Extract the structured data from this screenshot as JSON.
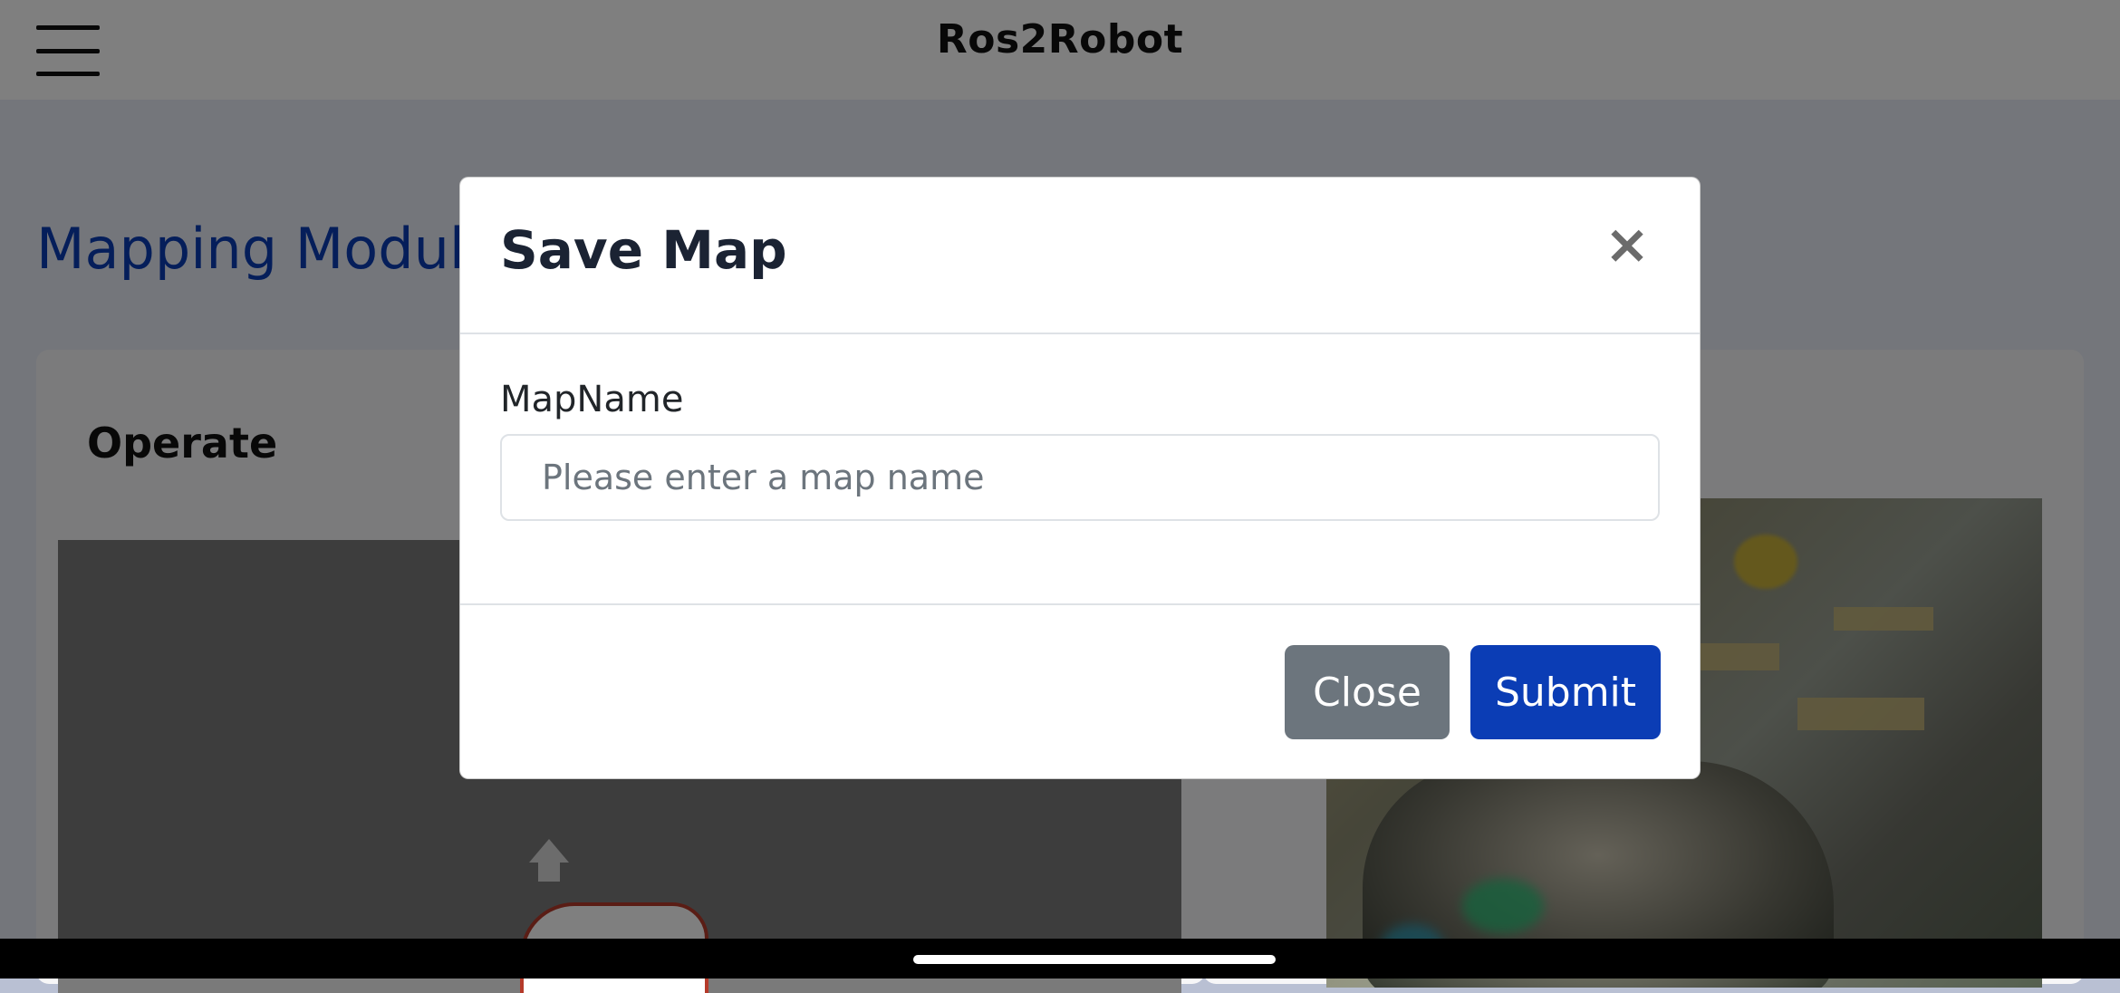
{
  "app": {
    "title": "Ros2Robot"
  },
  "page": {
    "module_title": "Mapping Module",
    "operate_title": "Operate"
  },
  "modal": {
    "title": "Save Map",
    "close_icon": "×",
    "field_label": "MapName",
    "field_placeholder": "Please enter a map name",
    "field_value": "",
    "close_label": "Close",
    "submit_label": "Submit"
  },
  "colors": {
    "accent": "#0b3db5",
    "secondary": "#6c757d",
    "overlay": "rgba(0,0,0,0.5)"
  },
  "icons": {
    "menu": "hamburger-menu-icon",
    "close": "close-icon"
  }
}
